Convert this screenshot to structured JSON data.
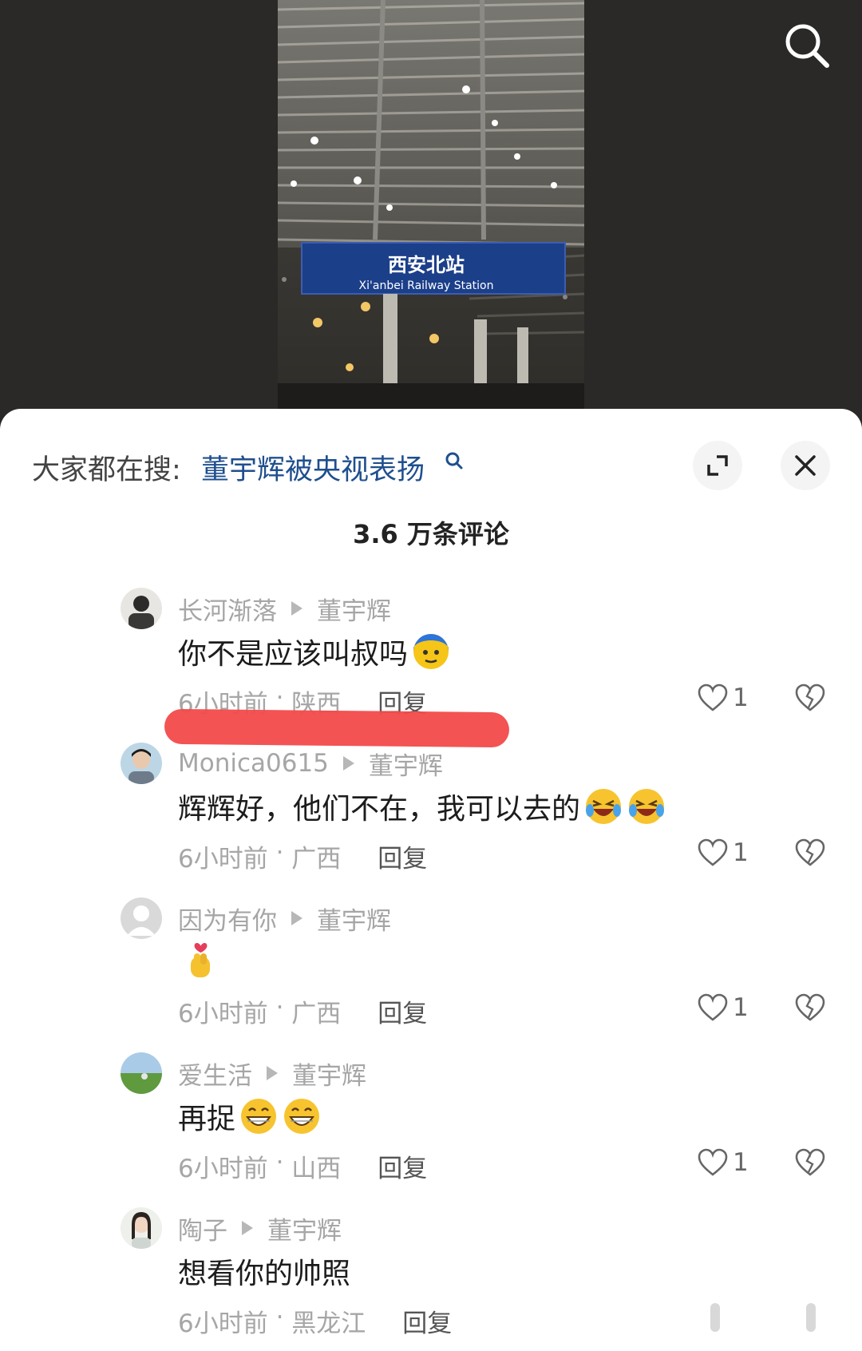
{
  "video": {
    "sign_cn": "西安北站",
    "sign_en": "Xi'anbei Railway Station"
  },
  "topbar": {
    "hot_prefix": "大家都在搜:",
    "hot_link": "董宇辉被央视表扬"
  },
  "comments_count": "3.6 万条评论",
  "comments": [
    {
      "user": "长河渐落",
      "reply_to": "董宇辉",
      "text": "你不是应该叫叔吗",
      "time": "6小时前",
      "region": "陕西",
      "reply_label": "回复",
      "likes": "1",
      "emojis": [
        "blue-face-emoji"
      ]
    },
    {
      "user": "Monica0615",
      "reply_to": "董宇辉",
      "text": "辉辉好，他们不在，我可以去的",
      "time": "6小时前",
      "region": "广西",
      "reply_label": "回复",
      "likes": "1",
      "emojis": [
        "laughing-crying-emoji",
        "laughing-crying-emoji"
      ]
    },
    {
      "user": "因为有你",
      "reply_to": "董宇辉",
      "text": "",
      "time": "6小时前",
      "region": "广西",
      "reply_label": "回复",
      "likes": "1",
      "emojis": [
        "finger-heart-emoji"
      ]
    },
    {
      "user": "爱生活",
      "reply_to": "董宇辉",
      "text": "再捉",
      "time": "6小时前",
      "region": "山西",
      "reply_label": "回复",
      "likes": "1",
      "emojis": [
        "grinning-emoji",
        "grinning-emoji"
      ]
    },
    {
      "user": "陶子",
      "reply_to": "董宇辉",
      "text": "想看你的帅照",
      "time": "6小时前",
      "region": "黑龙江",
      "reply_label": "回复",
      "likes": "",
      "emojis": []
    }
  ],
  "colors": {
    "link": "#1f4f8e",
    "muted": "#a6a6a6",
    "redaction": "#f24a4a"
  }
}
